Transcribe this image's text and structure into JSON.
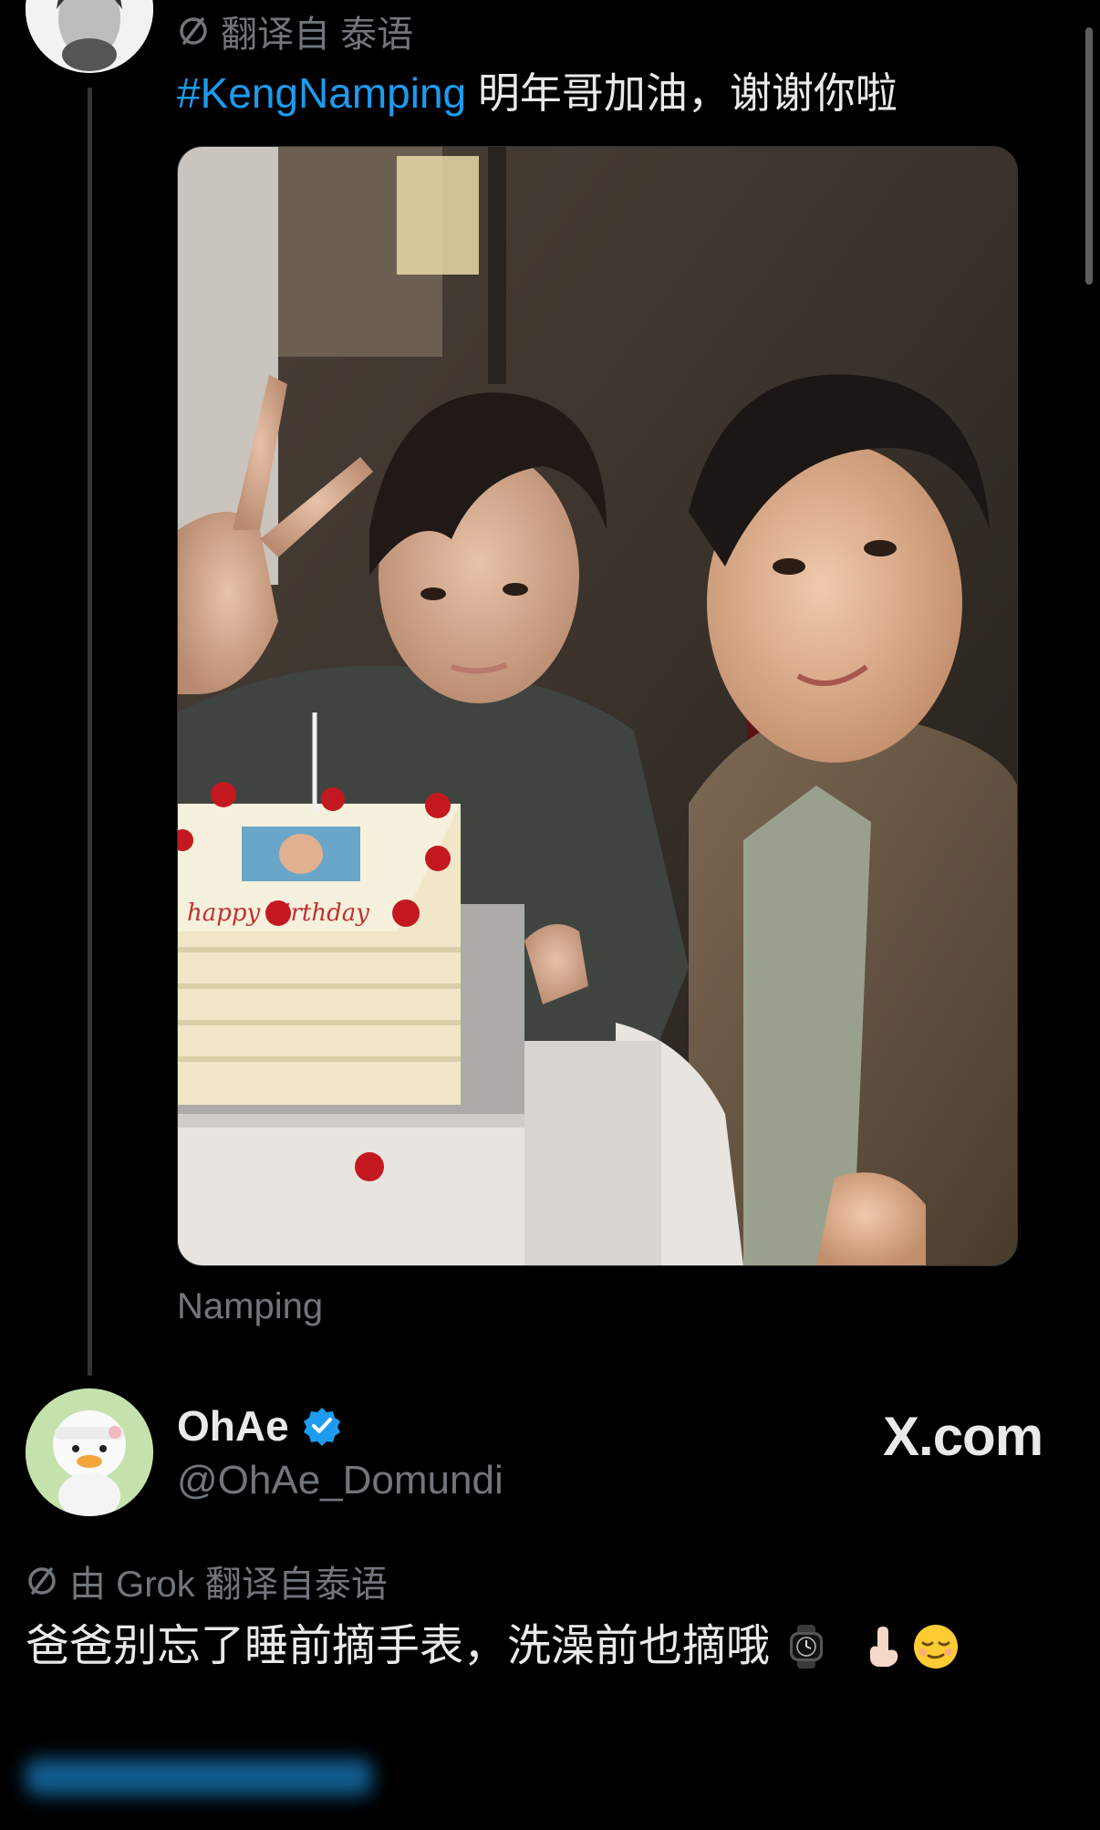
{
  "post": {
    "translation_label": "翻译自 泰语",
    "hashtag": "#KengNamping",
    "text": " 明年哥加油，谢谢你啦",
    "photo_caption": "Namping",
    "cake_text": "happy birthday"
  },
  "quote": {
    "display_name": "OhAe",
    "handle": "@OhAe_Domundi",
    "watermark": "X.com",
    "translation_label": "由 Grok 翻译自泰语",
    "text": "爸爸别忘了睡前摘手表，洗澡前也摘哦"
  },
  "colors": {
    "background": "#000000",
    "text_primary": "#e7e9ea",
    "text_secondary": "#71767b",
    "link": "#1d9bf0",
    "verified": "#1d9bf0"
  },
  "icons": {
    "translate": "slash-circle-icon",
    "verified": "verified-badge-icon",
    "emojis": [
      "watch-emoji",
      "pinched-hand-emoji",
      "relieved-face-emoji"
    ]
  }
}
